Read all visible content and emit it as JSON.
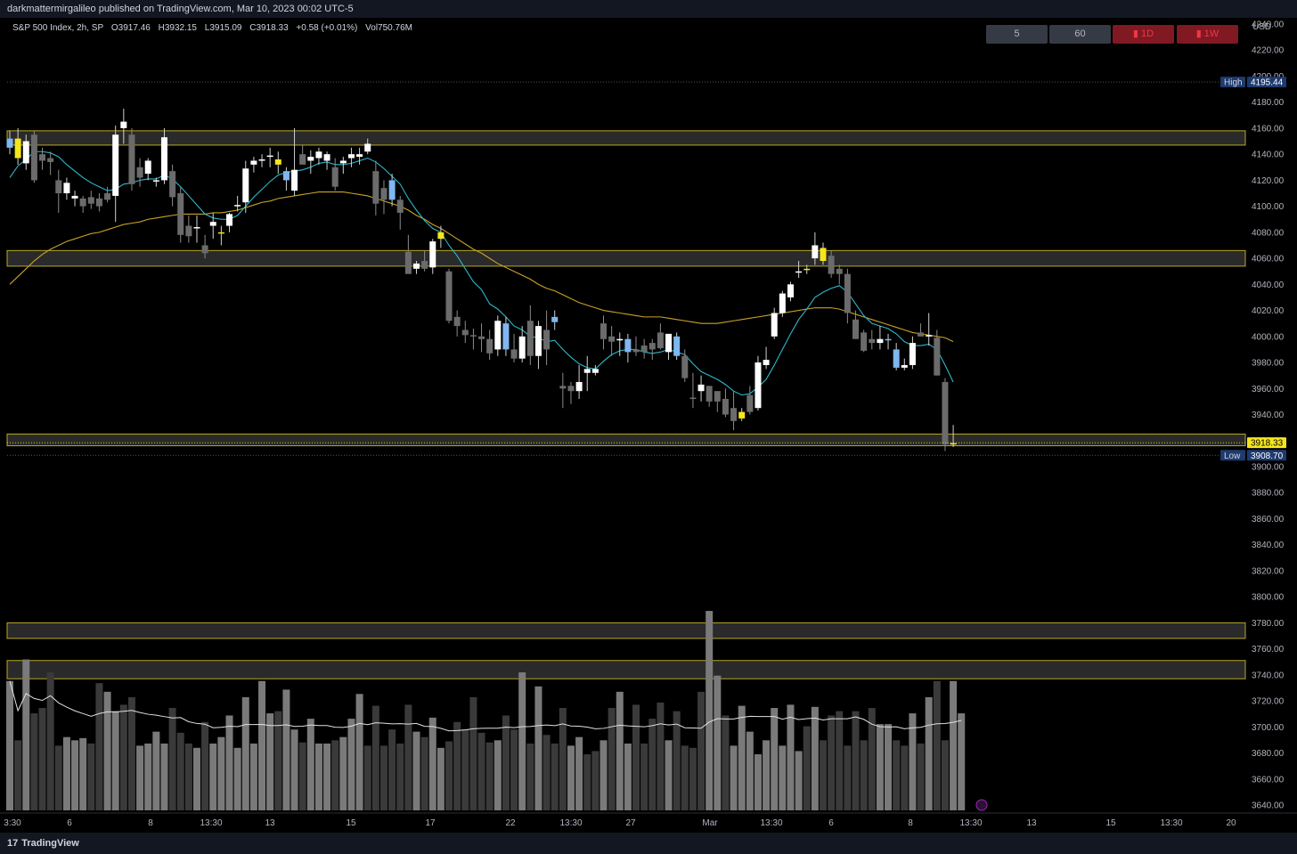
{
  "publish_line": "darkmattermirgalileo published on TradingView.com, Mar 10, 2023 00:02 UTC-5",
  "legend": {
    "symbol": "S&P 500 Index, 2h, SP",
    "open": "O3917.46",
    "high": "H3932.15",
    "low": "L3915.09",
    "close": "C3918.33",
    "change": "+0.58 (+0.01%)",
    "volume": "Vol750.76M"
  },
  "timeframes": [
    {
      "label": "5",
      "style": "gray"
    },
    {
      "label": "60",
      "style": "gray"
    },
    {
      "label": "▮ 1D",
      "style": "red"
    },
    {
      "label": "▮ 1W",
      "style": "red"
    }
  ],
  "footer": {
    "brand": "TradingView",
    "logo_glyph": "17"
  },
  "colors": {
    "bg": "#000000",
    "zone_fill": "#2a2a2a",
    "zone_border": "#b8a922",
    "candle_up": "#ffffff",
    "candle_down": "#6b6b6b",
    "highlight_yellow": "#f5e51c",
    "highlight_blue": "#7fb7f0",
    "ema_fast": "#2fb7c9",
    "ema_slow": "#c9a227",
    "badge_blue": "#1e3a6e",
    "price_badge": "#f5e51c"
  },
  "chart_data": {
    "type": "candlestick",
    "title": "S&P 500 Index, 2h, SP",
    "currency": "USD",
    "y_axis": {
      "unit_label": "USD",
      "range": [
        3630,
        4255
      ],
      "ticks": [
        "4240.00",
        "4220.00",
        "4200.00",
        "4180.00",
        "4160.00",
        "4140.00",
        "4120.00",
        "4100.00",
        "4080.00",
        "4060.00",
        "4040.00",
        "4020.00",
        "4000.00",
        "3980.00",
        "3960.00",
        "3940.00",
        "3920.00",
        "3900.00",
        "3880.00",
        "3860.00",
        "3840.00",
        "3820.00",
        "3800.00",
        "3780.00",
        "3760.00",
        "3740.00",
        "3720.00",
        "3700.00",
        "3680.00",
        "3660.00",
        "3640.00"
      ]
    },
    "x_ticks": [
      "3:30",
      "6",
      "8",
      "13:30",
      "13",
      "15",
      "17",
      "22",
      "13:30",
      "27",
      "Mar",
      "13:30",
      "6",
      "8",
      "13:30",
      "13",
      "15",
      "13:30",
      "20"
    ],
    "markers": {
      "high": {
        "label": "High",
        "value": "4195.44"
      },
      "low": {
        "label": "Low",
        "value": "3908.70"
      },
      "last": {
        "value": "3918.33"
      }
    },
    "zones": [
      {
        "from": 4147,
        "to": 4158
      },
      {
        "from": 4054,
        "to": 4066
      },
      {
        "from": 3916,
        "to": 3925
      },
      {
        "from": 3768,
        "to": 3780
      },
      {
        "from": 3737,
        "to": 3751
      }
    ],
    "candles": [
      [
        4145,
        4158,
        4140,
        4152,
        "blue"
      ],
      [
        4152,
        4160,
        4132,
        4137,
        "yellow"
      ],
      [
        4133,
        4155,
        4128,
        4150,
        "up"
      ],
      [
        4155,
        4158,
        4118,
        4120,
        "down"
      ],
      [
        4140,
        4145,
        4128,
        4135,
        "down"
      ],
      [
        4137,
        4142,
        4124,
        4134,
        "down"
      ],
      [
        4120,
        4128,
        4095,
        4110,
        "down"
      ],
      [
        4110,
        4122,
        4105,
        4118,
        "up"
      ],
      [
        4106,
        4112,
        4100,
        4108,
        "up"
      ],
      [
        4100,
        4108,
        4095,
        4106,
        "down"
      ],
      [
        4107,
        4112,
        4098,
        4102,
        "down"
      ],
      [
        4106,
        4110,
        4096,
        4100,
        "down"
      ],
      [
        4105,
        4115,
        4103,
        4110,
        "down"
      ],
      [
        4108,
        4162,
        4088,
        4155,
        "up"
      ],
      [
        4165,
        4175,
        4148,
        4160,
        "up"
      ],
      [
        4155,
        4160,
        4112,
        4117,
        "down"
      ],
      [
        4122,
        4137,
        4115,
        4130,
        "down"
      ],
      [
        4125,
        4137,
        4120,
        4135,
        "up"
      ],
      [
        4120,
        4122,
        4115,
        4120,
        "up"
      ],
      [
        4120,
        4160,
        4117,
        4153,
        "up"
      ],
      [
        4127,
        4132,
        4100,
        4107,
        "down"
      ],
      [
        4110,
        4115,
        4072,
        4078,
        "down"
      ],
      [
        4085,
        4093,
        4072,
        4077,
        "down"
      ],
      [
        4084,
        4093,
        4072,
        4084,
        "up"
      ],
      [
        4070,
        4078,
        4060,
        4064,
        "down"
      ],
      [
        4085,
        4095,
        4075,
        4088,
        "up"
      ],
      [
        4080,
        4085,
        4070,
        4080,
        "yellow"
      ],
      [
        4085,
        4095,
        4080,
        4094,
        "up"
      ],
      [
        4100,
        4108,
        4096,
        4101,
        "up"
      ],
      [
        4103,
        4135,
        4095,
        4129,
        "up"
      ],
      [
        4132,
        4138,
        4126,
        4135,
        "up"
      ],
      [
        4135,
        4140,
        4130,
        4136,
        "up"
      ],
      [
        4138,
        4145,
        4130,
        4139,
        "up"
      ],
      [
        4136,
        4142,
        4125,
        4132,
        "yellow"
      ],
      [
        4120,
        4130,
        4112,
        4127,
        "blue"
      ],
      [
        4112,
        4160,
        4108,
        4128,
        "up"
      ],
      [
        4140,
        4147,
        4133,
        4132,
        "down"
      ],
      [
        4135,
        4143,
        4125,
        4138,
        "up"
      ],
      [
        4137,
        4145,
        4132,
        4142,
        "up"
      ],
      [
        4135,
        4142,
        4128,
        4140,
        "up"
      ],
      [
        4130,
        4137,
        4112,
        4115,
        "down"
      ],
      [
        4133,
        4138,
        4125,
        4135,
        "up"
      ],
      [
        4137,
        4145,
        4130,
        4140,
        "up"
      ],
      [
        4138,
        4145,
        4132,
        4140,
        "up"
      ],
      [
        4148,
        4152,
        4140,
        4142,
        "up"
      ],
      [
        4127,
        4135,
        4093,
        4102,
        "down"
      ],
      [
        4114,
        4120,
        4094,
        4105,
        "down"
      ],
      [
        4120,
        4125,
        4100,
        4105,
        "blue"
      ],
      [
        4105,
        4108,
        4082,
        4095,
        "down"
      ],
      [
        4065,
        4078,
        4050,
        4048,
        "down"
      ],
      [
        4052,
        4058,
        4048,
        4056,
        "up"
      ],
      [
        4058,
        4066,
        4050,
        4052,
        "down"
      ],
      [
        4053,
        4075,
        4048,
        4073,
        "up"
      ],
      [
        4075,
        4085,
        4068,
        4080,
        "yellow"
      ],
      [
        4050,
        4052,
        4010,
        4012,
        "down"
      ],
      [
        4015,
        4020,
        4000,
        4008,
        "down"
      ],
      [
        4005,
        4012,
        3995,
        4001,
        "down"
      ],
      [
        4001,
        4006,
        3990,
        4000,
        "down"
      ],
      [
        4000,
        4010,
        3988,
        3998,
        "down"
      ],
      [
        3998,
        4005,
        3982,
        3987,
        "down"
      ],
      [
        3990,
        4016,
        3985,
        4012,
        "up"
      ],
      [
        4010,
        4015,
        3985,
        3990,
        "blue"
      ],
      [
        3990,
        4002,
        3980,
        3983,
        "down"
      ],
      [
        3983,
        4008,
        3980,
        4000,
        "up"
      ],
      [
        4012,
        4024,
        3978,
        3985,
        "down"
      ],
      [
        3985,
        4012,
        3975,
        4008,
        "up"
      ],
      [
        4005,
        4020,
        3978,
        3990,
        "down"
      ],
      [
        4015,
        4020,
        4005,
        4011,
        "blue"
      ],
      [
        3962,
        3972,
        3945,
        3960,
        "down"
      ],
      [
        3958,
        3965,
        3948,
        3962,
        "down"
      ],
      [
        3958,
        3978,
        3952,
        3965,
        "up"
      ],
      [
        3975,
        3985,
        3958,
        3972,
        "up"
      ],
      [
        3975,
        3978,
        3970,
        3972,
        "up"
      ],
      [
        3998,
        4016,
        3990,
        4010,
        "down"
      ],
      [
        4000,
        4008,
        3985,
        3996,
        "down"
      ],
      [
        3998,
        4003,
        3985,
        3998,
        "up"
      ],
      [
        3988,
        4002,
        3980,
        3998,
        "blue"
      ],
      [
        3990,
        4000,
        3985,
        3988,
        "down"
      ],
      [
        3993,
        3998,
        3983,
        3988,
        "down"
      ],
      [
        3995,
        3998,
        3982,
        3990,
        "down"
      ],
      [
        4003,
        4010,
        3990,
        3991,
        "down"
      ],
      [
        3988,
        4001,
        3982,
        4002,
        "up"
      ],
      [
        4000,
        4003,
        3982,
        3985,
        "blue"
      ],
      [
        3985,
        3990,
        3965,
        3968,
        "down"
      ],
      [
        3953,
        3972,
        3945,
        3952,
        "down"
      ],
      [
        3963,
        3970,
        3950,
        3958,
        "up"
      ],
      [
        3950,
        3962,
        3946,
        3962,
        "down"
      ],
      [
        3950,
        3958,
        3942,
        3958,
        "down"
      ],
      [
        3952,
        3960,
        3938,
        3940,
        "down"
      ],
      [
        3935,
        3958,
        3928,
        3945,
        "down"
      ],
      [
        3937,
        3945,
        3935,
        3942,
        "yellow"
      ],
      [
        3942,
        3962,
        3940,
        3955,
        "down"
      ],
      [
        3945,
        3985,
        3943,
        3980,
        "up"
      ],
      [
        3978,
        3992,
        3975,
        3982,
        "up"
      ],
      [
        4000,
        4022,
        3998,
        4018,
        "up"
      ],
      [
        4018,
        4035,
        4015,
        4033,
        "up"
      ],
      [
        4030,
        4042,
        4027,
        4040,
        "up"
      ],
      [
        4050,
        4058,
        4045,
        4050,
        "up"
      ],
      [
        4052,
        4055,
        4048,
        4051,
        "yellow"
      ],
      [
        4060,
        4080,
        4055,
        4070,
        "up"
      ],
      [
        4068,
        4072,
        4055,
        4058,
        "yellow"
      ],
      [
        4062,
        4066,
        4045,
        4048,
        "down"
      ],
      [
        4052,
        4055,
        4040,
        4048,
        "down"
      ],
      [
        4048,
        4052,
        4010,
        4018,
        "down"
      ],
      [
        4013,
        4020,
        4000,
        3998,
        "down"
      ],
      [
        4003,
        4005,
        3988,
        3989,
        "down"
      ],
      [
        3998,
        4005,
        3990,
        3995,
        "down"
      ],
      [
        3995,
        4008,
        3990,
        3998,
        "up"
      ],
      [
        3998,
        4002,
        3990,
        3998,
        "blue"
      ],
      [
        3990,
        3995,
        3974,
        3976,
        "blue"
      ],
      [
        3978,
        3983,
        3974,
        3976,
        "up"
      ],
      [
        3978,
        4000,
        3975,
        3995,
        "up"
      ],
      [
        4003,
        4010,
        4000,
        4000,
        "down"
      ],
      [
        4000,
        4018,
        3993,
        4001,
        "up"
      ],
      [
        3999,
        4005,
        3970,
        3970,
        "down"
      ],
      [
        3965,
        3968,
        3912,
        3917,
        "down"
      ],
      [
        3917,
        3932,
        3915,
        3918,
        "yellow"
      ]
    ],
    "ema_fast": [
      4122,
      4131,
      4136,
      4142,
      4142,
      4141,
      4138,
      4132,
      4127,
      4122,
      4118,
      4115,
      4112,
      4113,
      4117,
      4118,
      4120,
      4121,
      4121,
      4124,
      4121,
      4115,
      4108,
      4101,
      4094,
      4091,
      4090,
      4090,
      4093,
      4100,
      4107,
      4113,
      4119,
      4124,
      4126,
      4127,
      4128,
      4130,
      4133,
      4134,
      4132,
      4132,
      4133,
      4135,
      4137,
      4134,
      4129,
      4123,
      4117,
      4106,
      4097,
      4089,
      4083,
      4080,
      4070,
      4062,
      4052,
      4042,
      4036,
      4025,
      4021,
      4015,
      4008,
      4005,
      4000,
      3999,
      3996,
      3997,
      3990,
      3984,
      3979,
      3976,
      3975,
      3981,
      3986,
      3989,
      3990,
      3990,
      3988,
      3987,
      3988,
      3990,
      3988,
      3986,
      3979,
      3973,
      3970,
      3967,
      3963,
      3958,
      3955,
      3956,
      3961,
      3967,
      3978,
      3990,
      4002,
      4013,
      4021,
      4030,
      4034,
      4037,
      4039,
      4034,
      4025,
      4016,
      4010,
      4008,
      4006,
      4002,
      3996,
      3993,
      3993,
      3994,
      3990,
      3978,
      3965
    ],
    "ema_slow": [
      4040,
      4046,
      4052,
      4058,
      4063,
      4067,
      4070,
      4073,
      4075,
      4077,
      4079,
      4080,
      4082,
      4084,
      4086,
      4087,
      4088,
      4090,
      4091,
      4092,
      4093,
      4094,
      4094,
      4094,
      4094,
      4095,
      4095,
      4096,
      4097,
      4099,
      4101,
      4103,
      4104,
      4106,
      4107,
      4108,
      4109,
      4110,
      4111,
      4111,
      4111,
      4111,
      4110,
      4109,
      4108,
      4106,
      4104,
      4102,
      4100,
      4097,
      4093,
      4090,
      4086,
      4083,
      4079,
      4075,
      4071,
      4067,
      4064,
      4060,
      4056,
      4053,
      4050,
      4047,
      4044,
      4040,
      4037,
      4035,
      4032,
      4029,
      4026,
      4024,
      4022,
      4020,
      4019,
      4018,
      4017,
      4016,
      4015,
      4015,
      4015,
      4014,
      4013,
      4012,
      4011,
      4010,
      4010,
      4010,
      4011,
      4012,
      4013,
      4014,
      4015,
      4016,
      4017,
      4018,
      4019,
      4020,
      4021,
      4022,
      4022,
      4022,
      4021,
      4019,
      4017,
      4015,
      4013,
      4011,
      4009,
      4007,
      4005,
      4003,
      4002,
      4001,
      4000,
      3999,
      3996
    ],
    "volume": [
      120,
      65,
      140,
      90,
      95,
      128,
      60,
      68,
      65,
      67,
      62,
      118,
      110,
      92,
      98,
      105,
      60,
      62,
      73,
      62,
      95,
      72,
      62,
      58,
      82,
      62,
      68,
      88,
      58,
      105,
      62,
      120,
      90,
      92,
      112,
      75,
      63,
      85,
      62,
      62,
      65,
      68,
      85,
      108,
      60,
      97,
      60,
      75,
      62,
      98,
      73,
      68,
      86,
      58,
      64,
      82,
      75,
      105,
      72,
      63,
      65,
      88,
      75,
      128,
      62,
      115,
      70,
      62,
      95,
      60,
      68,
      52,
      55,
      65,
      95,
      110,
      62,
      98,
      62,
      85,
      100,
      65,
      92,
      60,
      58,
      110,
      185,
      125,
      88,
      60,
      97,
      73,
      52,
      65,
      95,
      60,
      98,
      55,
      78,
      96,
      65,
      88,
      92,
      60,
      92,
      65,
      95,
      80,
      80,
      65,
      60,
      90,
      62,
      105,
      120,
      65,
      120,
      90
    ]
  }
}
